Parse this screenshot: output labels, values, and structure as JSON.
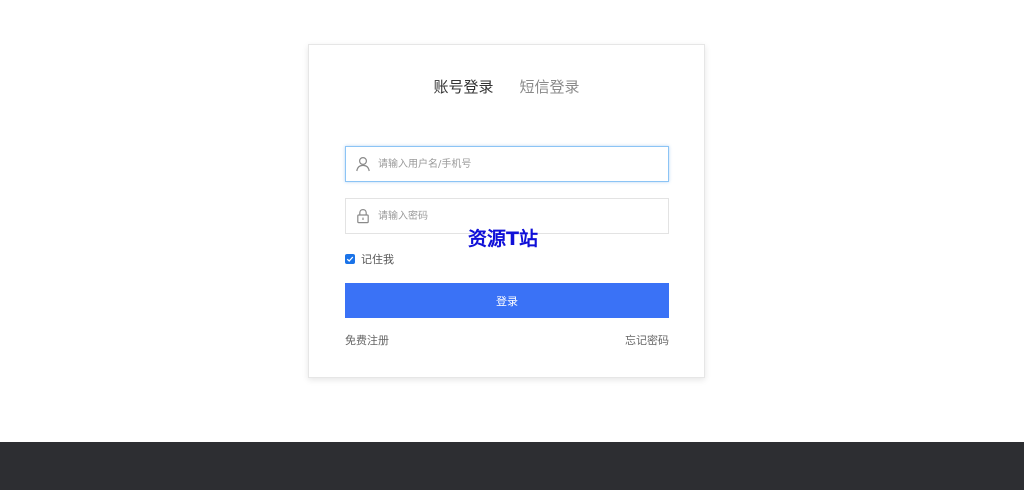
{
  "login": {
    "tabs": [
      {
        "label": "账号登录",
        "active": true
      },
      {
        "label": "短信登录",
        "active": false
      }
    ],
    "username": {
      "value": "",
      "placeholder": "请输入用户名/手机号",
      "icon": "user-icon"
    },
    "password": {
      "value": "",
      "placeholder": "请输入密码",
      "icon": "lock-icon"
    },
    "remember": {
      "label": "记住我",
      "checked": true
    },
    "submit_label": "登录",
    "register_link": "免费注册",
    "forgot_link": "忘记密码"
  },
  "watermark": "资源T站",
  "colors": {
    "primary_button": "#3a72f6",
    "footer": "#2d2e32",
    "watermark": "#1010d8",
    "input_focus": "#8cc4f5"
  }
}
